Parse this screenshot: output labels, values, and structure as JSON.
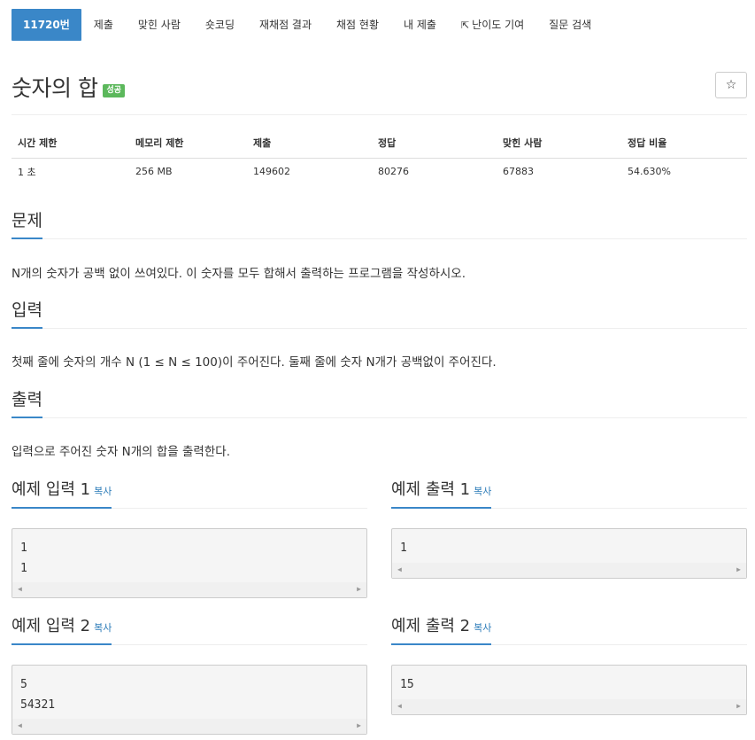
{
  "nav": {
    "problem_id": "11720번",
    "submit": "제출",
    "solved_users": "맞힌 사람",
    "short_coding": "숏코딩",
    "rejudge_result": "재채점 결과",
    "judge_status": "채점 현황",
    "my_submissions": "내 제출",
    "difficulty_contrib": "난이도 기여",
    "question_search": "질문 검색"
  },
  "problem": {
    "title": "숫자의 합",
    "status_badge": "성공",
    "star": "☆"
  },
  "stats": {
    "headers": [
      "시간 제한",
      "메모리 제한",
      "제출",
      "정답",
      "맞힌 사람",
      "정답 비율"
    ],
    "values": [
      "1 초",
      "256 MB",
      "149602",
      "80276",
      "67883",
      "54.630%"
    ]
  },
  "sections": {
    "description_title": "문제",
    "description": "N개의 숫자가 공백 없이 쓰여있다. 이 숫자를 모두 합해서 출력하는 프로그램을 작성하시오.",
    "input_title": "입력",
    "input": "첫째 줄에 숫자의 개수 N (1 ≤ N ≤ 100)이 주어진다. 둘째 줄에 숫자 N개가 공백없이 주어진다.",
    "output_title": "출력",
    "output": "입력으로 주어진 숫자 N개의 합을 출력한다."
  },
  "samples": [
    {
      "input_title": "예제 입력 1",
      "input_copy": "복사",
      "input_lines": [
        "1",
        "1"
      ],
      "output_title": "예제 출력 1",
      "output_copy": "복사",
      "output_lines": [
        "1"
      ]
    },
    {
      "input_title": "예제 입력 2",
      "input_copy": "복사",
      "input_lines": [
        "5",
        "54321"
      ],
      "output_title": "예제 출력 2",
      "output_copy": "복사",
      "output_lines": [
        "15"
      ]
    }
  ],
  "colors": {
    "accent": "#3a87c8",
    "success": "#5cb85c",
    "link": "#2a7ab8"
  }
}
